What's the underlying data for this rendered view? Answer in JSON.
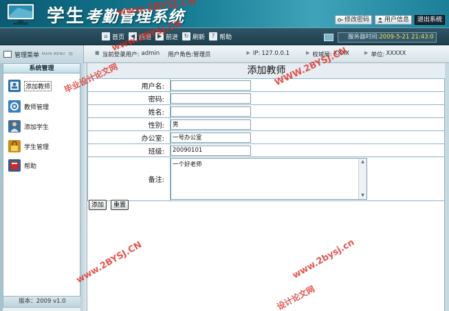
{
  "app": {
    "title_main": "学生",
    "title_emph": "考勤管理系统"
  },
  "header": {
    "buttons": {
      "change_password": "修改密码",
      "user_info": "用户信息",
      "logout": "退出系统"
    }
  },
  "nav": {
    "items": [
      {
        "label": "首页",
        "icon": "home-icon"
      },
      {
        "label": "后退",
        "icon": "back-icon"
      },
      {
        "label": "前进",
        "icon": "forward-icon"
      },
      {
        "label": "刷新",
        "icon": "refresh-icon"
      },
      {
        "label": "帮助",
        "icon": "help-icon"
      }
    ],
    "server_label": "服务器时间:",
    "server_time": "2009-5-21 21:43:0"
  },
  "status": {
    "panel_title": "管理菜单",
    "panel_sub": "MAIN MENU",
    "current_user_label": "当前登录用户:",
    "current_user": "admin",
    "role_label": "用户角色:",
    "role": "管理员",
    "ip_label": "IP:",
    "ip": "127.0.0.1",
    "dept_label": "校域局:",
    "dept": "XXXX",
    "unit_label": "单位:",
    "unit": "XXXXX"
  },
  "sidebar": {
    "title": "系统管理",
    "items": [
      {
        "label": "添加教师",
        "icon": "add-teacher-icon",
        "active": true
      },
      {
        "label": "教师管理",
        "icon": "teacher-manage-icon"
      },
      {
        "label": "添加学生",
        "icon": "add-student-icon"
      },
      {
        "label": "学生管理",
        "icon": "student-manage-icon"
      },
      {
        "label": "帮助",
        "icon": "help-book-icon"
      }
    ],
    "version": "版本：2009 v1.0"
  },
  "form": {
    "title": "添加教师",
    "fields": {
      "username": {
        "label": "用户名:",
        "value": ""
      },
      "password": {
        "label": "密码:",
        "value": ""
      },
      "name": {
        "label": "姓名:",
        "value": ""
      },
      "gender": {
        "label": "性别:",
        "value": "男"
      },
      "office": {
        "label": "办公室:",
        "value": "一号办公室"
      },
      "class": {
        "label": "班级:",
        "value": "20090101"
      },
      "remark": {
        "label": "备注:",
        "value": "一个好老师"
      }
    },
    "buttons": {
      "submit": "添加",
      "reset": "重置"
    }
  },
  "watermarks": {
    "site": "www.2BYSJ.CN",
    "site_upper": "WWW.2BYSJ.CN",
    "site_lower": "www.2bysj.cn",
    "cn_graduation": "毕业设计论文网",
    "cn_partial": "设计论文网"
  },
  "colors": {
    "header_bg": "#137a91",
    "nav_bg": "#244a5a",
    "border": "#8cb4c4",
    "watermark": "#de281e"
  }
}
